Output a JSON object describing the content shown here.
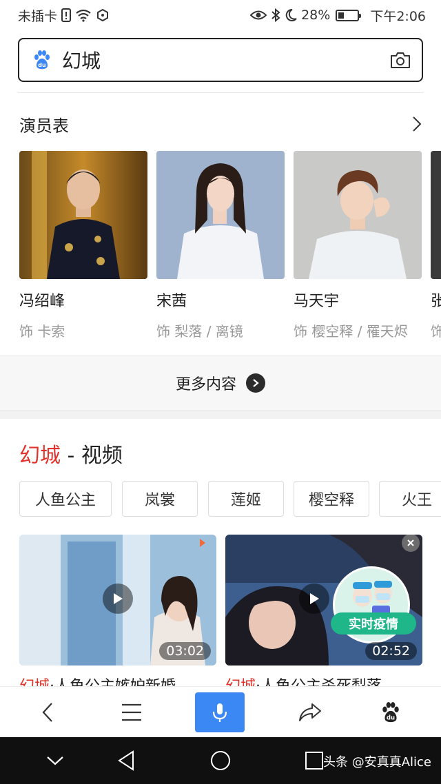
{
  "status_bar": {
    "carrier": "未插卡",
    "battery": "28%",
    "time": "下午2:06"
  },
  "search": {
    "query": "幻城"
  },
  "cast": {
    "title": "演员表",
    "members": [
      {
        "name": "冯绍峰",
        "role": "饰 卡索"
      },
      {
        "name": "宋茜",
        "role": "饰 梨落 / 离镜"
      },
      {
        "name": "马天宇",
        "role": "饰 樱空释 / 罹天烬"
      },
      {
        "name": "张",
        "role": "饰"
      }
    ],
    "more_label": "更多内容"
  },
  "videos": {
    "title_highlight": "幻城",
    "title_rest": " - 视频",
    "tags": [
      "人鱼公主",
      "岚裳",
      "莲姬",
      "樱空释",
      "火王"
    ],
    "items": [
      {
        "caption_highlight": "幻城",
        "caption_rest": "·人鱼公主嫉妒新婚",
        "duration": "03:02"
      },
      {
        "caption_highlight": "幻城",
        "caption_rest": "·人鱼公主杀死梨落",
        "duration": "02:52",
        "badge": "实时疫情"
      }
    ]
  },
  "watermark": "头条 @安真真Alice",
  "colors": {
    "accent_red": "#e0322a",
    "mic_blue": "#3b88f5",
    "badge_green": "#1fb68a"
  }
}
